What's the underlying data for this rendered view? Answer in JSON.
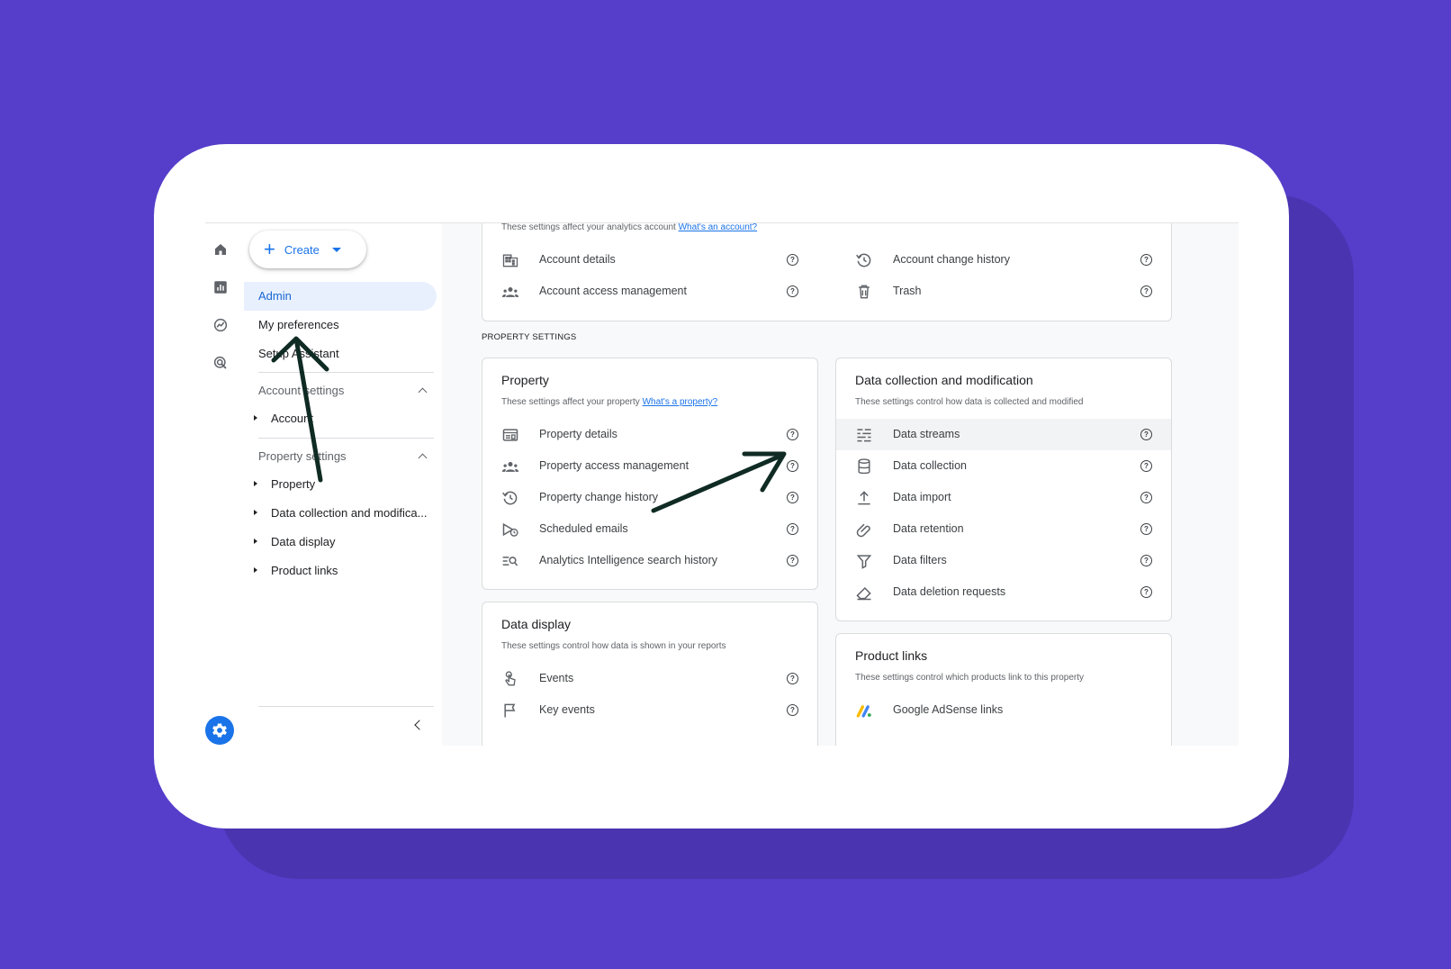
{
  "nav": {
    "create_label": "Create",
    "items": {
      "admin": "Admin",
      "my_preferences": "My preferences",
      "setup_assistant": "Setup Assistant",
      "account_settings": "Account settings",
      "account": "Account",
      "property_settings": "Property settings",
      "property": "Property",
      "data_collection": "Data collection and modifica...",
      "data_display": "Data display",
      "product_links": "Product links"
    }
  },
  "account_panel": {
    "subtitle": "These settings affect your analytics account",
    "link": "What's an account?",
    "rows": [
      "Account details",
      "Account access management",
      "Account change history",
      "Trash"
    ]
  },
  "section_label": "PROPERTY SETTINGS",
  "property_panel": {
    "title": "Property",
    "subtitle": "These settings affect your property",
    "link": "What's a property?",
    "rows": [
      "Property details",
      "Property access management",
      "Property change history",
      "Scheduled emails",
      "Analytics Intelligence search history"
    ]
  },
  "data_collection_panel": {
    "title": "Data collection and modification",
    "subtitle": "These settings control how data is collected and modified",
    "rows": [
      "Data streams",
      "Data collection",
      "Data import",
      "Data retention",
      "Data filters",
      "Data deletion requests"
    ]
  },
  "data_display_panel": {
    "title": "Data display",
    "subtitle": "These settings control how data is shown in your reports",
    "rows": [
      "Events",
      "Key events"
    ]
  },
  "product_links_panel": {
    "title": "Product links",
    "subtitle": "These settings control which products link to this property",
    "rows": [
      "Google AdSense links"
    ]
  },
  "colors": {
    "background": "#563ecb",
    "accent": "#1a73e8",
    "annotation_arrow": "#0f2b23"
  }
}
